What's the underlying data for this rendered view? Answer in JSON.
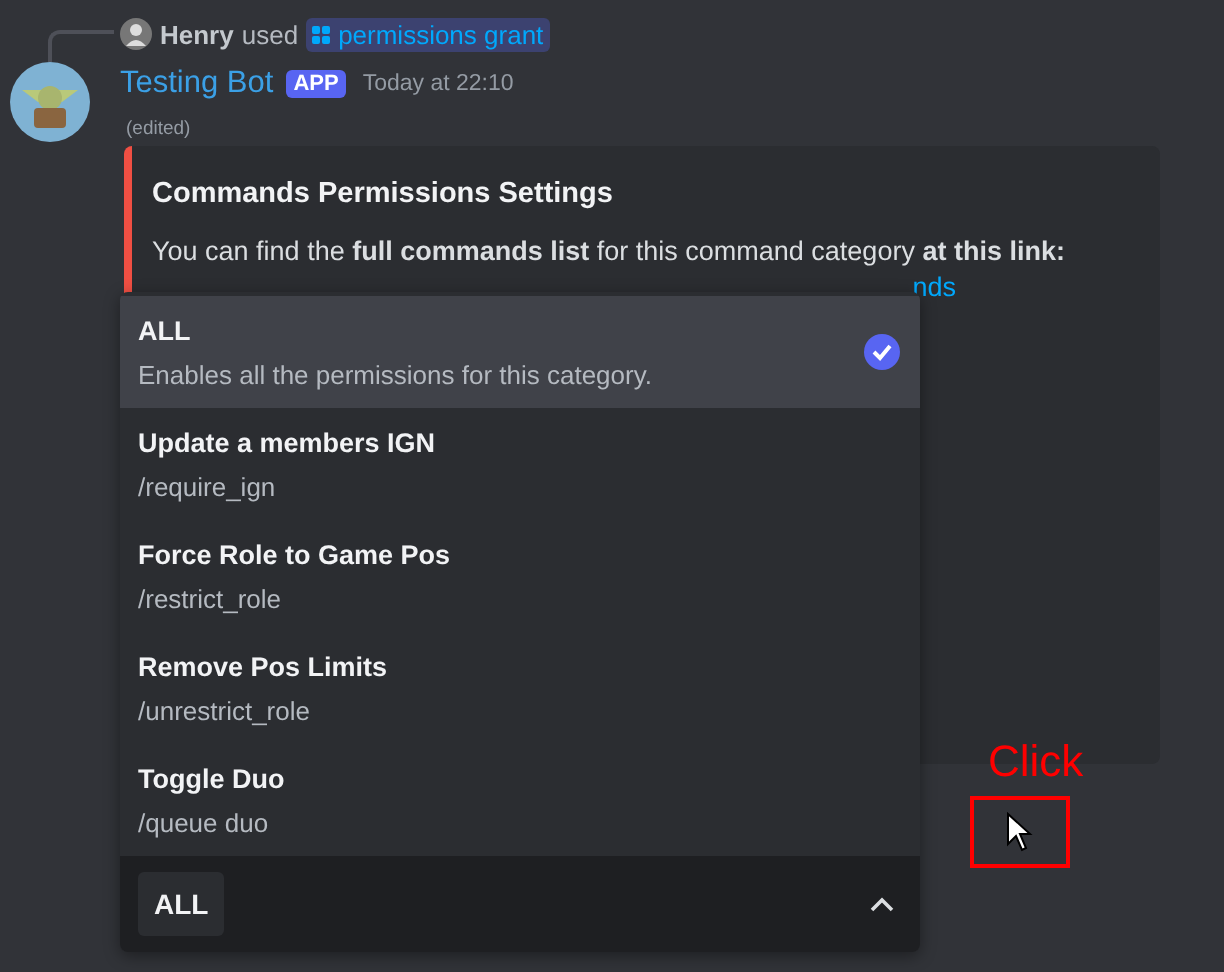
{
  "reply": {
    "user": "Henry",
    "verb": "used",
    "command": "permissions grant"
  },
  "message": {
    "author": "Testing Bot",
    "badge": "APP",
    "timestamp": "Today at 22:10",
    "edited": "(edited)"
  },
  "embed": {
    "title": "Commands Permissions Settings",
    "description": "You can find the **full commands list** for this command category **at this link:**",
    "link": "nds"
  },
  "dropdown": {
    "expanded": true,
    "value": "ALL",
    "options": [
      {
        "label": "ALL",
        "description": "Enables all the permissions for this category.",
        "selected": true
      },
      {
        "label": "Update a members IGN",
        "description": "/require_ign",
        "selected": false
      },
      {
        "label": "Force Role to Game Pos",
        "description": "/restrict_role",
        "selected": false
      },
      {
        "label": "Remove Pos Limits",
        "description": "/unrestrict_role",
        "selected": false
      },
      {
        "label": "Toggle Duo",
        "description": "/queue duo",
        "selected": false
      }
    ]
  },
  "annotation": {
    "label": "Click"
  }
}
